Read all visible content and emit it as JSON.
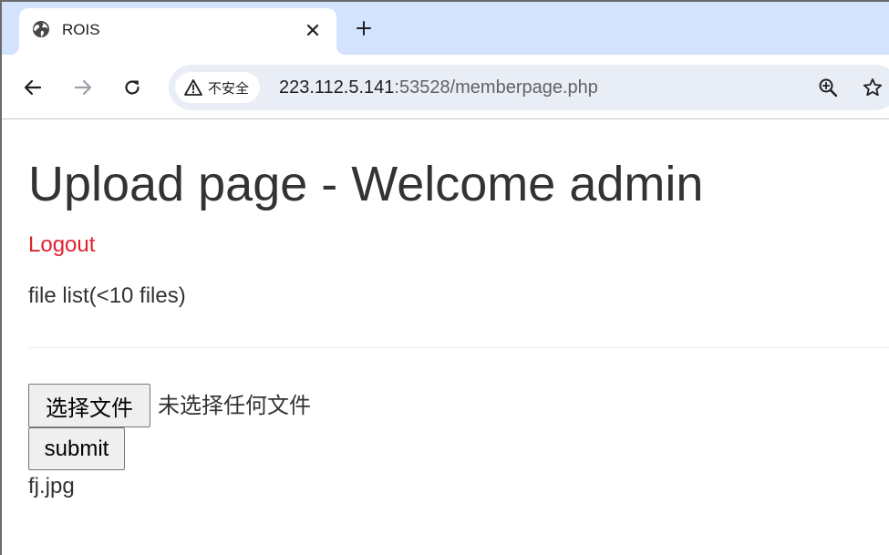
{
  "browser": {
    "tab": {
      "title": "ROIS",
      "favicon_icon": "globe-icon",
      "close_icon": "close-icon"
    },
    "new_tab_icon": "plus-icon",
    "toolbar": {
      "back_icon": "arrow-left-icon",
      "forward_icon": "arrow-right-icon",
      "reload_icon": "reload-icon"
    },
    "omnibox": {
      "security_icon": "warning-triangle-icon",
      "security_label": "不安全",
      "url_host": "223.112.5.141",
      "url_rest": ":53528/memberpage.php",
      "zoom_icon": "zoom-in-icon",
      "bookmark_icon": "star-icon"
    }
  },
  "page": {
    "heading": "Upload page - Welcome admin",
    "logout_label": "Logout",
    "file_list_label": "file list(<10 files)",
    "upload_form": {
      "choose_file_label": "选择文件",
      "no_file_text": "未选择任何文件",
      "submit_label": "submit"
    },
    "files": [
      "fj.jpg"
    ]
  },
  "colors": {
    "tabstrip_bg": "#d3e3fd",
    "omnibox_bg": "#e9eef6",
    "link": "#e0222f",
    "text": "#333333"
  }
}
